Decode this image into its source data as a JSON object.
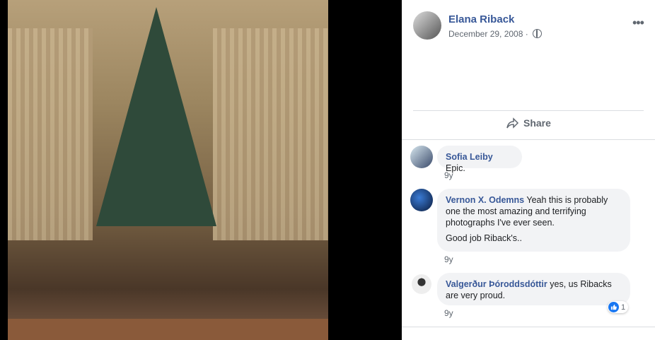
{
  "post": {
    "author": "Elana Riback",
    "date": "December 29, 2008 ·",
    "more_icon": "more-horizontal-icon",
    "privacy_icon": "globe-icon"
  },
  "actions": {
    "share_label": "Share"
  },
  "comments": [
    {
      "name": "Sofia Leiby",
      "text": "Epic.",
      "time": "9y"
    },
    {
      "name": "Vernon X. Odemns",
      "text": "Yeah this is probably one the most amazing and terrifying photographs I've ever seen.",
      "text2": "Good job Riback's..",
      "time": "9y"
    },
    {
      "name": "Valgerður Þóroddsdóttir",
      "text": "yes, us Ribacks are very proud.",
      "time": "9y",
      "reaction_count": "1"
    }
  ],
  "colors": {
    "link": "#385898",
    "bubble": "#f2f3f5",
    "like": "#1877f2"
  }
}
